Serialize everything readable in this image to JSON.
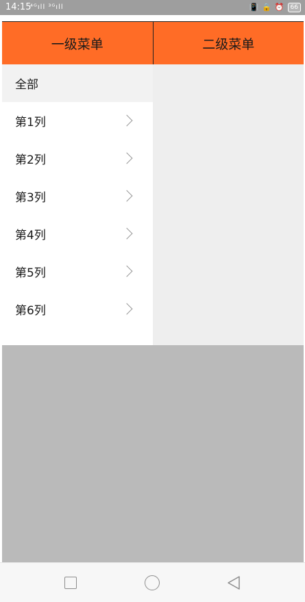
{
  "status_bar": {
    "time": "14:15",
    "signals": "⁴ᴳıll ³ᴳıll",
    "battery": "66"
  },
  "tabs": [
    {
      "label": "一级菜单"
    },
    {
      "label": "二级菜单"
    }
  ],
  "colors": {
    "accent": "#ff6c26",
    "overlay": "#bababa"
  },
  "menu": {
    "all_label": "全部",
    "items": [
      {
        "label": "第1列"
      },
      {
        "label": "第2列"
      },
      {
        "label": "第3列"
      },
      {
        "label": "第4列"
      },
      {
        "label": "第5列"
      },
      {
        "label": "第6列"
      }
    ]
  },
  "icons": {
    "chevron": "chevron-right-icon",
    "nav_recent": "square-icon",
    "nav_home": "circle-icon",
    "nav_back": "triangle-back-icon"
  }
}
